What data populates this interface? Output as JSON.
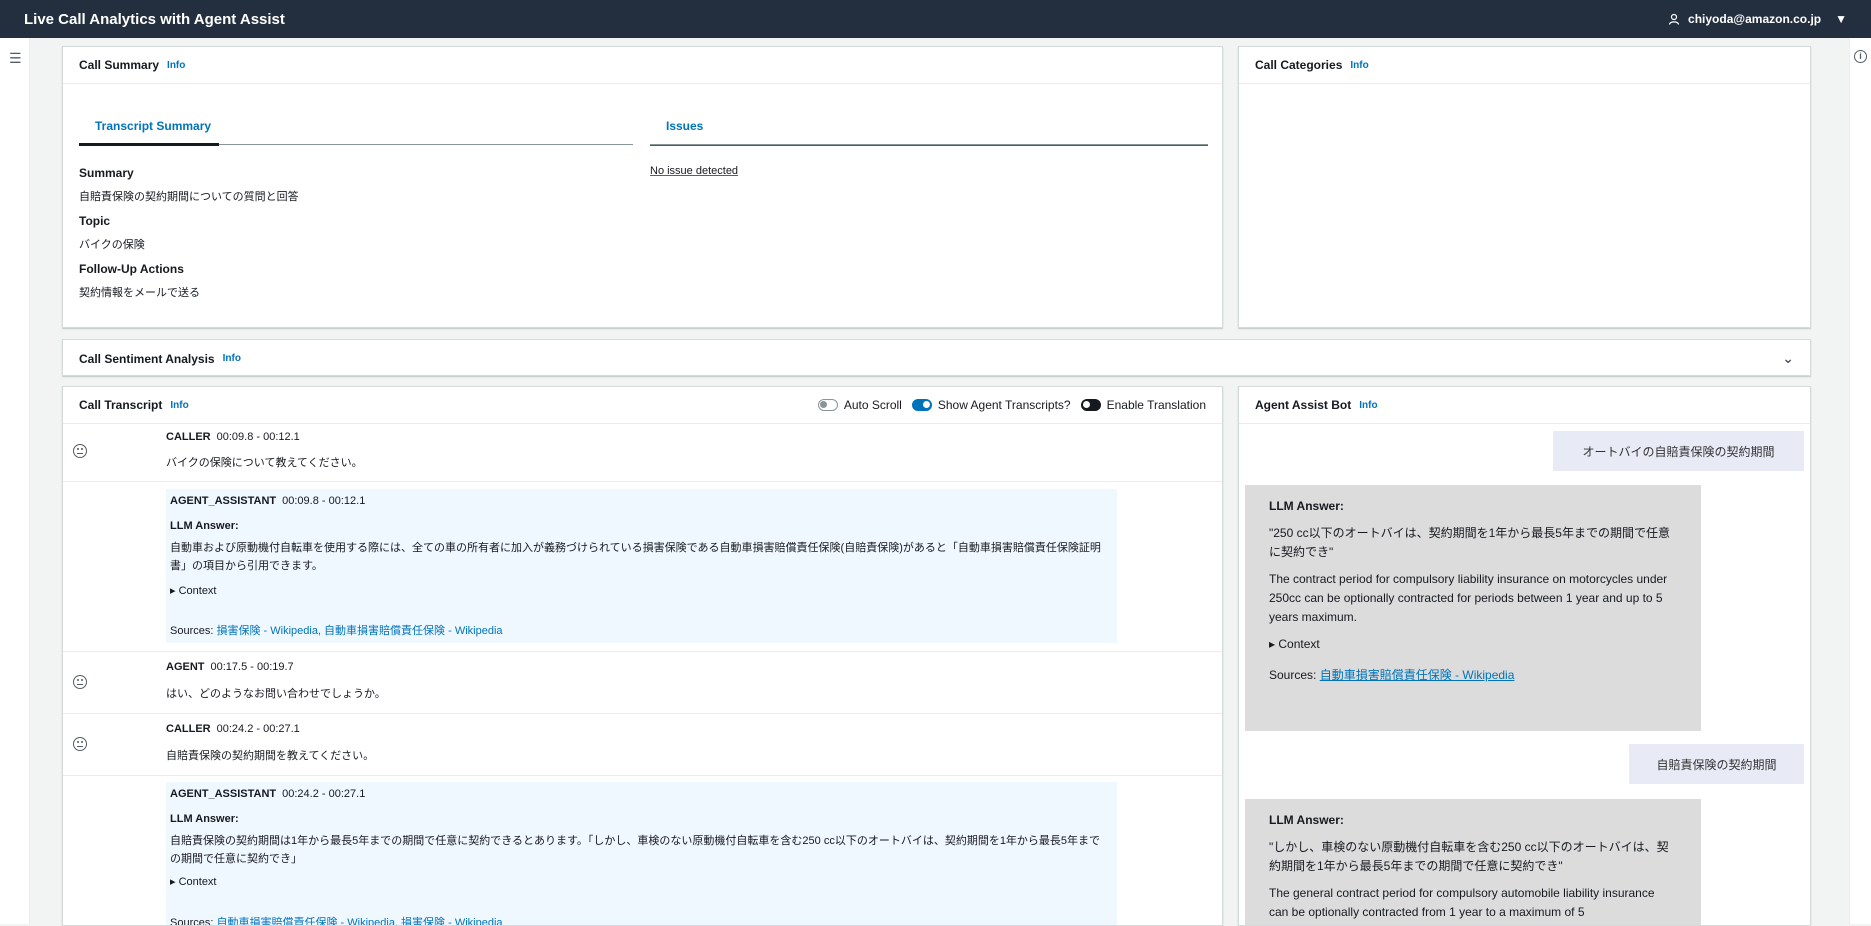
{
  "app": {
    "title": "Live Call Analytics with Agent Assist",
    "user": "chiyoda@amazon.co.jp"
  },
  "info": "Info",
  "call_summary": {
    "title": "Call Summary",
    "tabs": [
      "Transcript Summary",
      "Issues"
    ],
    "summary_label": "Summary",
    "summary_value": "自賠責保険の契約期間についての質問と回答",
    "topic_label": "Topic",
    "topic_value": "バイクの保険",
    "followup_label": "Follow-Up Actions",
    "followup_value": "契約情報をメールで送る",
    "issue_text": "No issue detected"
  },
  "call_categories": {
    "title": "Call Categories"
  },
  "sentiment": {
    "title": "Call Sentiment Analysis"
  },
  "transcript": {
    "title": "Call Transcript",
    "toggles": [
      "Auto Scroll",
      "Show Agent Transcripts?",
      "Enable Translation"
    ],
    "entries": [
      {
        "speaker": "CALLER",
        "time": "00:09.8 - 00:12.1",
        "text": "バイクの保険について教えてください。"
      },
      {
        "speaker": "AGENT_ASSISTANT",
        "time": "00:09.8 - 00:12.1",
        "llm": "LLM Answer:",
        "text": "自動車および原動機付自転車を使用する際には、全ての車の所有者に加入が義務づけられている損害保険である自動車損害賠償責任保険(自賠責保険)があると「自動車損害賠償責任保険証明書」の項目から引用できます。",
        "context": "▸ Context",
        "sources_label": "Sources:",
        "sources": "損害保険 - Wikipedia, 自動車損害賠償責任保険 - Wikipedia"
      },
      {
        "speaker": "AGENT",
        "time": "00:17.5 - 00:19.7",
        "text": "はい、どのようなお問い合わせでしょうか。"
      },
      {
        "speaker": "CALLER",
        "time": "00:24.2 - 00:27.1",
        "text": "自賠責保険の契約期間を教えてください。"
      },
      {
        "speaker": "AGENT_ASSISTANT",
        "time": "00:24.2 - 00:27.1",
        "llm": "LLM Answer:",
        "text": "自賠責保険の契約期間は1年から最長5年までの期間で任意に契約できるとあります。「しかし、車検のない原動機付自転車を含む250 cc以下のオートバイは、契約期間を1年から最長5年までの期間で任意に契約でき」",
        "context": "▸ Context",
        "sources_label": "Sources:",
        "sources": "自動車損害賠償責任保険 - Wikipedia, 損害保険 - Wikipedia"
      }
    ]
  },
  "bot": {
    "title": "Agent Assist Bot",
    "messages": [
      {
        "question": "オートバイの自賠責保険の契約期間"
      },
      {
        "header": "LLM Answer:",
        "quote": "\"250 cc以下のオートバイは、契約期間を1年から最長5年までの期間で任意に契約でき\"",
        "answer": "The contract period for compulsory liability insurance on motorcycles under 250cc can be optionally contracted for periods between 1 year and up to 5 years maximum.",
        "context": "▸ Context",
        "sources_label": "Sources:",
        "sources": "自動車損害賠償責任保険 - Wikipedia"
      },
      {
        "question": "自賠責保険の契約期間"
      },
      {
        "header": "LLM Answer:",
        "quote": "\"しかし、車検のない原動機付自転車を含む250 cc以下のオートバイは、契約期間を1年から最長5年までの期間で任意に契約でき\"",
        "answer": "The general contract period for compulsory automobile liability insurance can be optionally contracted from 1 year to a maximum of 5"
      }
    ]
  }
}
